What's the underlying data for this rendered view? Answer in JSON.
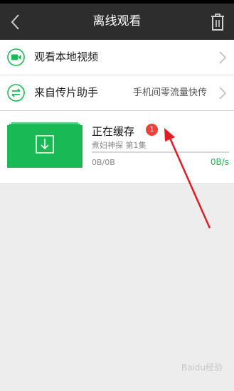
{
  "header": {
    "title": "离线观看",
    "back_icon": "back-arrow-icon",
    "trash_icon": "trash-icon"
  },
  "menu": [
    {
      "label": "观看本地视频",
      "sub": "",
      "icon": "video-icon"
    },
    {
      "label": "来自传片助手",
      "sub": "手机间零流量快传",
      "icon": "transfer-icon"
    }
  ],
  "download": {
    "title": "正在缓存",
    "badge": "1",
    "subtitle": "煮妇神探 第1集",
    "size": "0B/0B",
    "speed": "0B/s",
    "progress": 0
  },
  "colors": {
    "accent": "#19b955",
    "badge": "#e8443c",
    "annotation": "#e31b23"
  },
  "watermark": "Baidu经验"
}
